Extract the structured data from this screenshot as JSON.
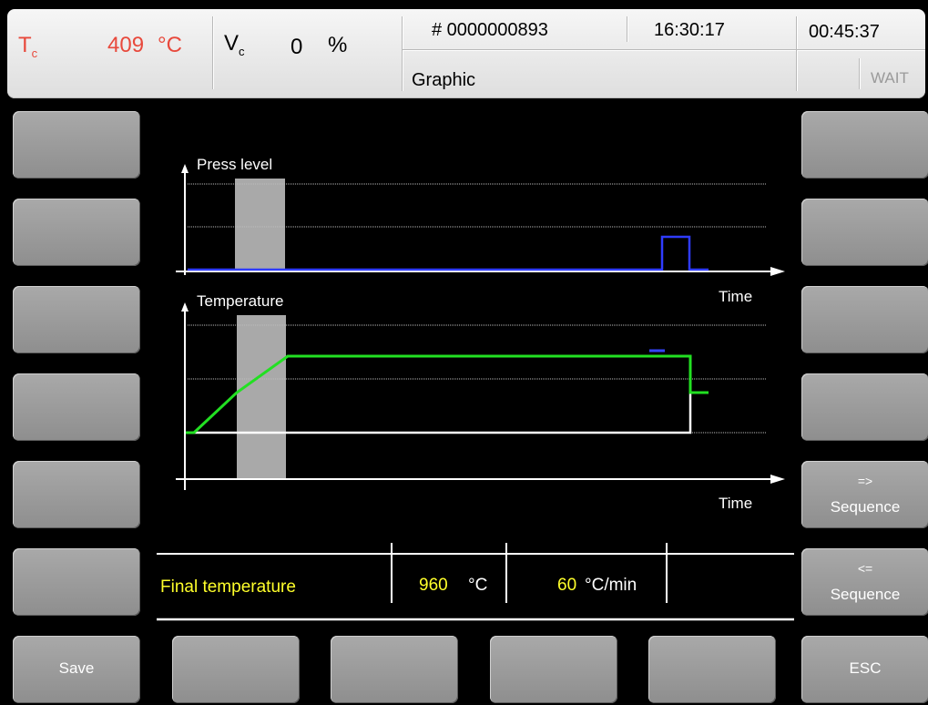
{
  "header": {
    "tc_symbol": "T",
    "tc_sub": "c",
    "tc_value": "409",
    "tc_unit": "°C",
    "vc_symbol": "V",
    "vc_sub": "c",
    "vc_value": "0",
    "vc_unit": "%",
    "program_number": "# 0000000893",
    "clock": "16:30:17",
    "elapsed": "00:45:37",
    "screen_title": "Graphic",
    "status": "WAIT"
  },
  "left_buttons": [
    "",
    "",
    "",
    "",
    "",
    ""
  ],
  "right_buttons": [
    {
      "top": "",
      "bottom": ""
    },
    {
      "top": "",
      "bottom": ""
    },
    {
      "top": "",
      "bottom": ""
    },
    {
      "top": "",
      "bottom": ""
    },
    {
      "top": "=>",
      "bottom": "Sequence"
    },
    {
      "top": "<=",
      "bottom": "Sequence"
    }
  ],
  "bottom_buttons": [
    "Save",
    "",
    "",
    "",
    "",
    "ESC"
  ],
  "chart": {
    "press_title": "Press level",
    "temp_title": "Temperature",
    "xlabel": "Time",
    "colors": {
      "press_line": "#2f3cff",
      "temperature_line": "#22e022",
      "actual_line": "#ffffff",
      "highlight_band": "#a9a9a9",
      "marker": "#3344ff"
    }
  },
  "info": {
    "label": "Final temperature",
    "temperature_value": "960",
    "temperature_unit": "°C",
    "rate_value": "60",
    "rate_unit": "°C/min"
  }
}
